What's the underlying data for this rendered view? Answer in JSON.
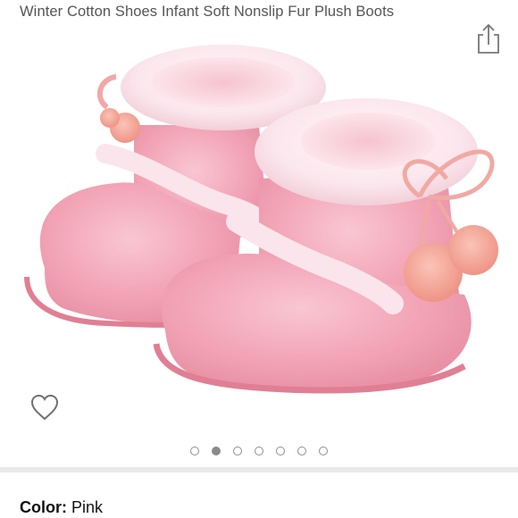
{
  "product": {
    "title": "Winter Cotton Shoes Infant Soft Nonslip Fur Plush Boots"
  },
  "icons": {
    "share": "share-icon",
    "favorite": "heart-outline-icon"
  },
  "gallery": {
    "image_count": 7,
    "active_index": 1
  },
  "color_selector": {
    "label": "Color:",
    "value": "Pink"
  },
  "colors": {
    "boot_pink": "#f3a6b8",
    "fur_white": "#fbe9ef",
    "pompom": "#f4a99b",
    "divider": "#e9e9e9"
  }
}
